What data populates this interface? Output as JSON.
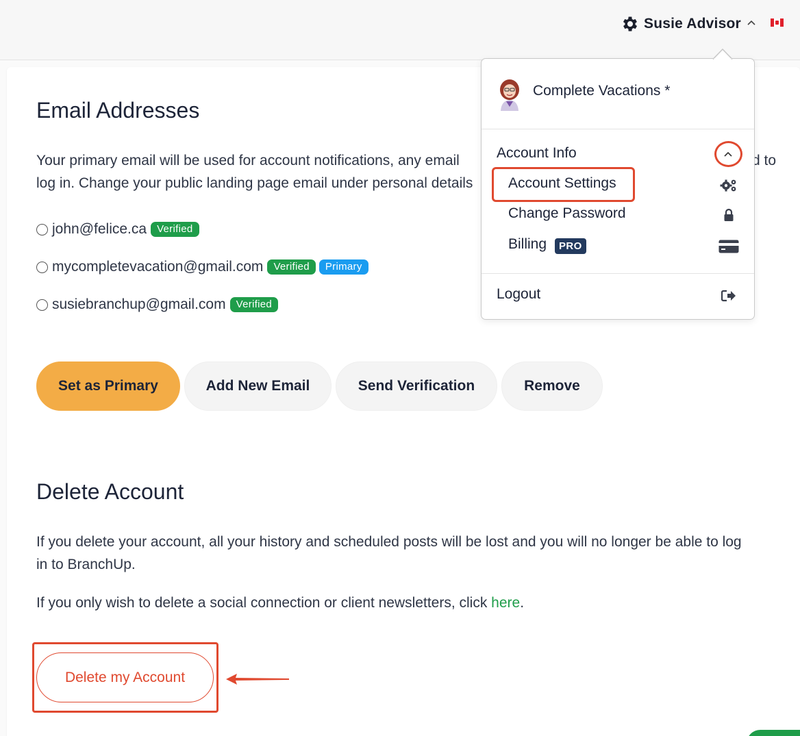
{
  "header": {
    "username": "Susie Advisor",
    "settings_icon": "gear-icon",
    "caret_icon": "chevron-up-icon",
    "flag_icon": "canada-flag-icon"
  },
  "emails": {
    "title": "Email Addresses",
    "description": "Your primary email will be used for account notifications, any email d to log in. Change your public landing page email under personal details",
    "description_line1_left": "Your primary email will be used for account notifications, any email",
    "description_line1_right": "d to",
    "description_line2": "log in. Change your public landing page email under personal details",
    "list": [
      {
        "address": "john@felice.ca",
        "badges": [
          "Verified"
        ]
      },
      {
        "address": "mycompletevacation@gmail.com",
        "badges": [
          "Verified",
          "Primary"
        ]
      },
      {
        "address": "susiebranchup@gmail.com",
        "badges": [
          "Verified"
        ]
      }
    ],
    "buttons": {
      "set_primary": "Set as Primary",
      "add_new": "Add New Email",
      "send_verification": "Send Verification",
      "remove": "Remove"
    }
  },
  "delete": {
    "title": "Delete Account",
    "warning": "If you delete your account, all your history and scheduled posts will be lost and you will no longer be able to log in to BranchUp.",
    "warning_line1": "If you delete your account, all your history and scheduled posts will be lost and you will no longer be able to log",
    "warning_line2": "in to BranchUp.",
    "social_prefix": "If you only wish to delete a social connection or client newsletters, click ",
    "social_link": "here",
    "social_suffix": ".",
    "button": "Delete my Account"
  },
  "dropdown": {
    "company": "Complete Vacations *",
    "section_label": "Account Info",
    "items": [
      {
        "label": "Account Settings",
        "icon": "cogs-icon"
      },
      {
        "label": "Change Password",
        "icon": "lock-icon"
      },
      {
        "label": "Billing",
        "icon": "credit-card-icon",
        "badge": "PRO"
      }
    ],
    "logout": "Logout",
    "logout_icon": "sign-out-icon"
  },
  "colors": {
    "accent_orange": "#f3ac46",
    "verified_green": "#1f9d4a",
    "primary_blue": "#1a9cf0",
    "danger_red": "#e0492f",
    "pro_navy": "#233a5e"
  }
}
